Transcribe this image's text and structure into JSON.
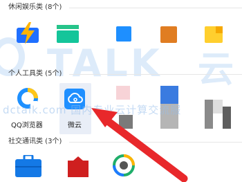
{
  "sections": {
    "leisure": {
      "title": "休闲娱乐类 (8个)"
    },
    "personal": {
      "title": "个人工具类 (5个)"
    },
    "social": {
      "title": "社交通讯类 (3个)"
    }
  },
  "apps": {
    "qq_browser": {
      "label": "QQ浏览器"
    },
    "weiyun": {
      "label": "微云"
    }
  },
  "watermark": {
    "brand": "TALK",
    "brand_suffix": "云",
    "url_line": "dctalk.com 国内专业云计算交流服"
  },
  "colors": {
    "accent": "#1f6fff",
    "arrow": "#e8282b",
    "selected_bg": "#e9eef7"
  }
}
